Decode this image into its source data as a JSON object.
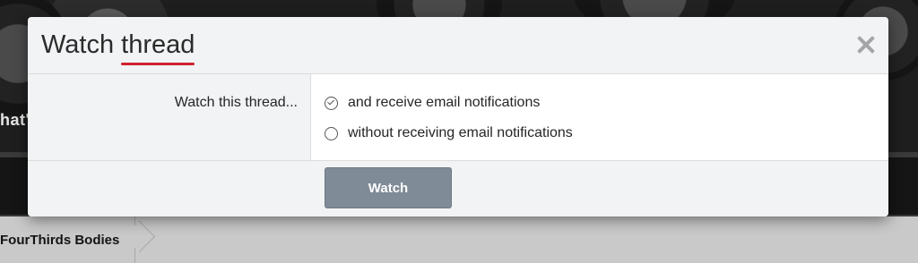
{
  "background": {
    "overlay_text": "hat's",
    "breadcrumb": {
      "label": "FourThirds Bodies"
    }
  },
  "dialog": {
    "title_prefix": "Watch ",
    "title_highlight": "thread",
    "form": {
      "label": "Watch this thread...",
      "options": [
        {
          "label": "and receive email notifications",
          "checked": true
        },
        {
          "label": "without receiving email notifications",
          "checked": false
        }
      ]
    },
    "submit_label": "Watch",
    "colors": {
      "title_underline": "#d0202b",
      "button_bg": "#7f8b96"
    },
    "icons": {
      "close": "close-icon"
    }
  }
}
